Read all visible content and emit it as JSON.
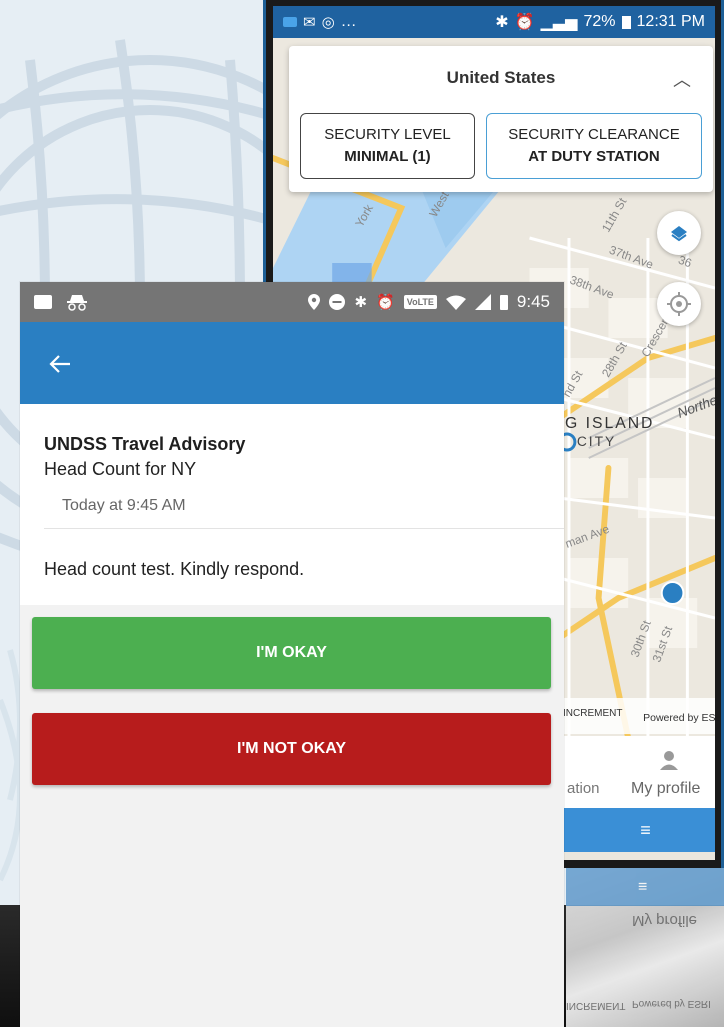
{
  "back_phone": {
    "status": {
      "left": "…",
      "right": "72%",
      "time": "12:31 PM"
    },
    "country": "United States",
    "security_level": {
      "label": "SECURITY LEVEL",
      "value": "MINIMAL (1)"
    },
    "security_clearance": {
      "label": "SECURITY CLEARANCE",
      "value": "AT DUTY STATION"
    },
    "map_labels": {
      "street_11th": "11th St",
      "ave_37th": "37th Ave",
      "ave_38th": "38th Ave",
      "st_28th": "28th St",
      "crescent": "Crescent",
      "north": "Northe",
      "nd_st": "nd St",
      "long_island": "G ISLAND",
      "city": "CITY",
      "man_ave": "man Ave",
      "st_30th": "30th St",
      "st_31st": "31st St",
      "west": "West",
      "york": "York",
      "ave_36": "36"
    },
    "attribution": {
      "increment": "INCREMENT",
      "powered": "Powered by ESRI"
    },
    "tabs": {
      "partial": "ation",
      "profile": "My profile"
    },
    "menu_icon": "≡"
  },
  "front_phone": {
    "status_time": "9:45",
    "lte": "VoLTE",
    "message": {
      "title": "UNDSS Travel Advisory",
      "subject": "Head Count for NY",
      "time": "Today at 9:45 AM",
      "body": "Head count test. Kindly respond."
    },
    "buttons": {
      "ok": "I'M OKAY",
      "not_ok": "I'M NOT OKAY"
    }
  },
  "reflection": {
    "profile": "My profile",
    "powered": "Powered by ESRI",
    "increment": "INCREMENT",
    "menu": "≡"
  },
  "colors": {
    "app_bar": "#2a7fc2",
    "ok_button": "#4caf50",
    "not_ok_button": "#b71c1c",
    "front_status_bar": "#757575",
    "back_status_bar": "#1f62a0"
  }
}
